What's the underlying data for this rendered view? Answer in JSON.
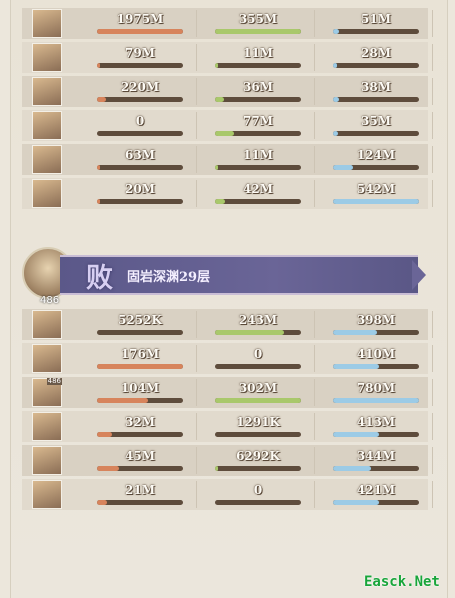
{
  "top_rows": [
    {
      "level": "",
      "dmg": "1975M",
      "dmg_ratio": 1.0,
      "heal": "355M",
      "heal_ratio": 1.0,
      "tank": "51M",
      "tank_ratio": 0.07
    },
    {
      "level": "",
      "dmg": "79M",
      "dmg_ratio": 0.04,
      "heal": "11M",
      "heal_ratio": 0.03,
      "tank": "28M",
      "tank_ratio": 0.05
    },
    {
      "level": "",
      "dmg": "220M",
      "dmg_ratio": 0.11,
      "heal": "36M",
      "heal_ratio": 0.1,
      "tank": "38M",
      "tank_ratio": 0.07
    },
    {
      "level": "",
      "dmg": "0",
      "dmg_ratio": 0.0,
      "heal": "77M",
      "heal_ratio": 0.22,
      "tank": "35M",
      "tank_ratio": 0.06
    },
    {
      "level": "",
      "dmg": "63M",
      "dmg_ratio": 0.03,
      "heal": "11M",
      "heal_ratio": 0.03,
      "tank": "124M",
      "tank_ratio": 0.23
    },
    {
      "level": "",
      "dmg": "20M",
      "dmg_ratio": 0.01,
      "heal": "42M",
      "heal_ratio": 0.12,
      "tank": "542M",
      "tank_ratio": 1.0
    }
  ],
  "battle": {
    "avatar_level": "486",
    "result": "败",
    "stage": "固岩深渊29层"
  },
  "bottom_rows": [
    {
      "level": "",
      "dmg": "5252K",
      "dmg_ratio": 0.0,
      "heal": "243M",
      "heal_ratio": 0.8,
      "tank": "398M",
      "tank_ratio": 0.51
    },
    {
      "level": "",
      "dmg": "176M",
      "dmg_ratio": 1.0,
      "heal": "0",
      "heal_ratio": 0.0,
      "tank": "410M",
      "tank_ratio": 0.53
    },
    {
      "level": "486",
      "dmg": "104M",
      "dmg_ratio": 0.59,
      "heal": "302M",
      "heal_ratio": 1.0,
      "tank": "780M",
      "tank_ratio": 1.0
    },
    {
      "level": "",
      "dmg": "32M",
      "dmg_ratio": 0.18,
      "heal": "1291K",
      "heal_ratio": 0.0,
      "tank": "413M",
      "tank_ratio": 0.53
    },
    {
      "level": "",
      "dmg": "45M",
      "dmg_ratio": 0.26,
      "heal": "6292K",
      "heal_ratio": 0.02,
      "tank": "344M",
      "tank_ratio": 0.44
    },
    {
      "level": "",
      "dmg": "21M",
      "dmg_ratio": 0.12,
      "heal": "0",
      "heal_ratio": 0.0,
      "tank": "421M",
      "tank_ratio": 0.54
    }
  ],
  "watermark": "Easck.Net",
  "colors": {
    "damage": "#d7845c",
    "heal": "#a9c86b",
    "tank": "#9ccbe6"
  }
}
